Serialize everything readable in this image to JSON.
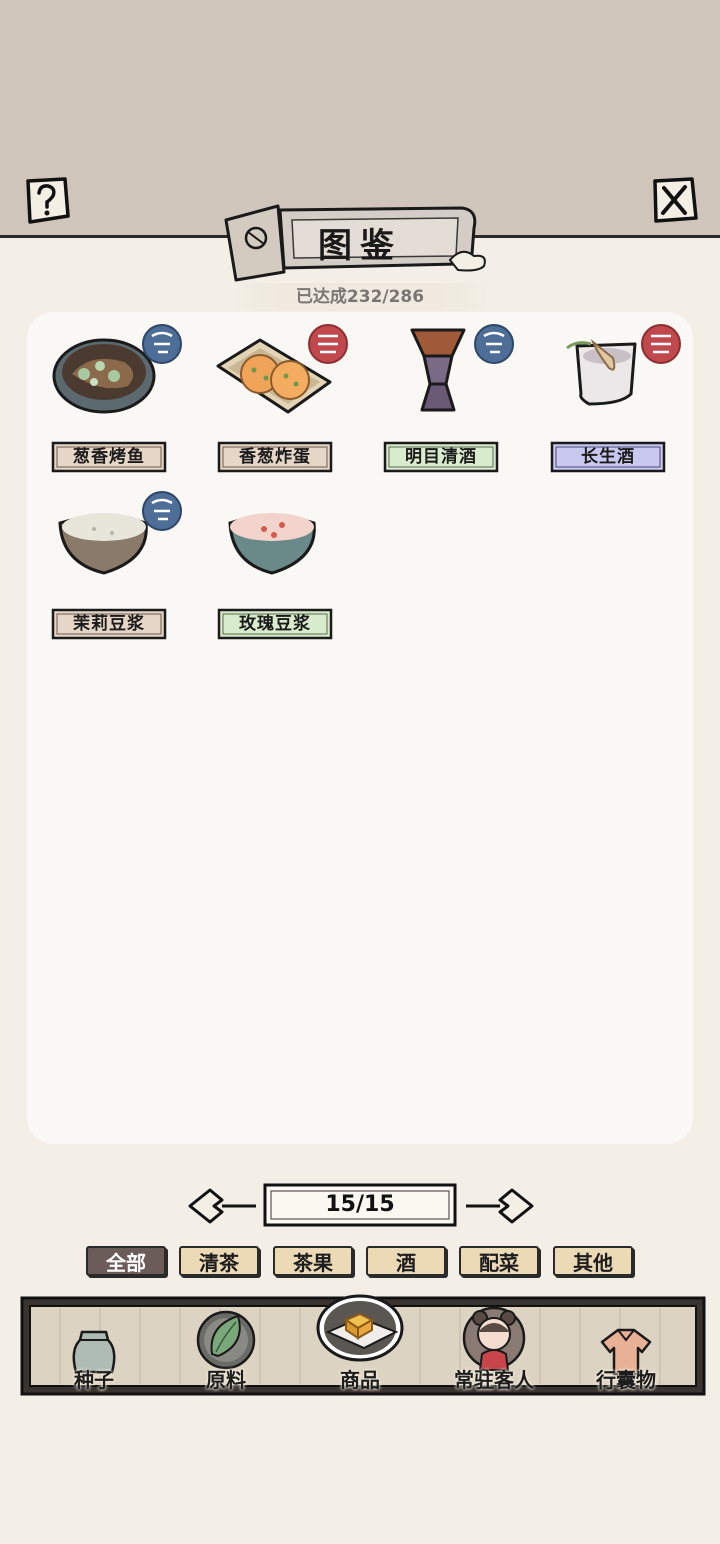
{
  "header": {
    "title": "图鉴",
    "progress": "已达成232/286"
  },
  "items": [
    {
      "name": "葱香烤鱼",
      "badge": "blue",
      "plate": "#e6d6c7"
    },
    {
      "name": "香葱炸蛋",
      "badge": "red",
      "plate": "#e6d6c7"
    },
    {
      "name": "明目清酒",
      "badge": "blue",
      "plate": "#d8ebcd"
    },
    {
      "name": "长生酒",
      "badge": "red",
      "plate": "#c9c8ee"
    },
    {
      "name": "茉莉豆浆",
      "badge": "blue",
      "plate": "#e6d6c7"
    },
    {
      "name": "玫瑰豆浆",
      "badge": "none",
      "plate": "#d8ebcd"
    }
  ],
  "pager": {
    "text": "15/15"
  },
  "tabs": [
    {
      "label": "全部",
      "active": true
    },
    {
      "label": "清茶",
      "active": false
    },
    {
      "label": "茶果",
      "active": false
    },
    {
      "label": "酒",
      "active": false
    },
    {
      "label": "配菜",
      "active": false
    },
    {
      "label": "其他",
      "active": false
    }
  ],
  "nav": [
    {
      "label": "种子",
      "icon": "seed-jar-icon"
    },
    {
      "label": "原料",
      "icon": "leaf-icon"
    },
    {
      "label": "商品",
      "icon": "tofu-plate-icon",
      "active": true
    },
    {
      "label": "常驻客人",
      "icon": "girl-avatar-icon"
    },
    {
      "label": "行囊物",
      "icon": "robe-icon"
    }
  ],
  "colors": {
    "badge_blue": "#4e6e98",
    "badge_red": "#c1484d",
    "tab_active": "#6b5b59",
    "tab_inactive": "#ecd9b6"
  }
}
